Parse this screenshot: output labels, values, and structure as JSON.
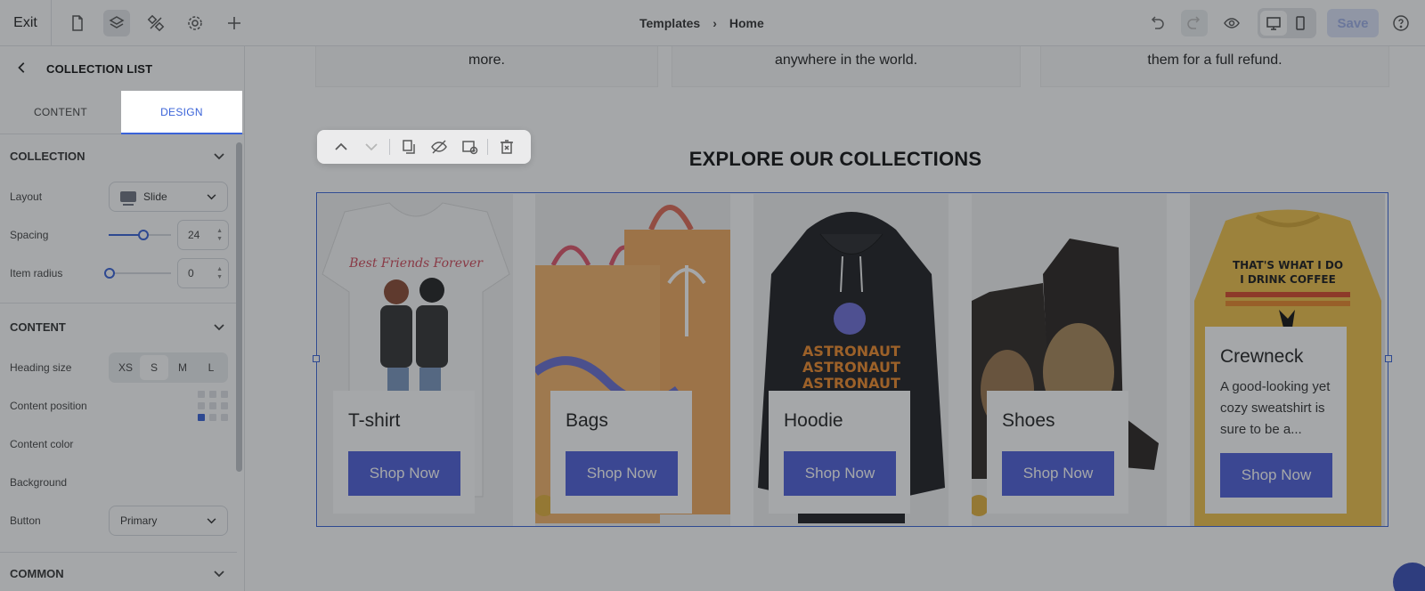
{
  "topbar": {
    "exit_label": "Exit",
    "breadcrumb": [
      "Templates",
      "Home"
    ],
    "save_label": "Save"
  },
  "sidebar": {
    "title": "COLLECTION LIST",
    "tabs": [
      "CONTENT",
      "DESIGN"
    ],
    "active_tab": "DESIGN",
    "collection_section": {
      "heading": "COLLECTION",
      "layout_label": "Layout",
      "layout_value": "Slide",
      "spacing_label": "Spacing",
      "spacing_value": "24",
      "radius_label": "Item radius",
      "radius_value": "0"
    },
    "content_section": {
      "heading": "CONTENT",
      "heading_size_label": "Heading size",
      "heading_sizes": [
        "XS",
        "S",
        "M",
        "L"
      ],
      "heading_size_selected": "S",
      "content_position_label": "Content position",
      "content_color_label": "Content color",
      "content_color": "#0b0b1e",
      "background_label": "Background",
      "button_label": "Button",
      "button_value": "Primary"
    },
    "common_section": {
      "heading": "COMMON"
    }
  },
  "canvas": {
    "features": [
      "more.",
      "anywhere in the world.",
      "them for a full refund."
    ],
    "section_heading": "EXPLORE OUR COLLECTIONS",
    "collections": [
      {
        "name": "T-shirt",
        "description": "",
        "button": "Shop Now"
      },
      {
        "name": "Bags",
        "description": "",
        "button": "Shop Now"
      },
      {
        "name": "Hoodie",
        "description": "",
        "button": "Shop Now"
      },
      {
        "name": "Shoes",
        "description": "",
        "button": "Shop Now"
      },
      {
        "name": "Crewneck",
        "description": "A good-looking yet cozy sweatshirt is sure to be a...",
        "button": "Shop Now"
      }
    ],
    "art_text": {
      "tshirt": "Best Friends Forever",
      "hoodie": "ASTRONAUT",
      "crewneck_line1": "THAT'S WHAT I DO",
      "crewneck_line2": "I DRINK COFFEE"
    }
  },
  "colors": {
    "accent": "#3a63d8",
    "shop_button": "#4f5fd9",
    "overlay": "rgba(30,34,40,0.40)"
  }
}
